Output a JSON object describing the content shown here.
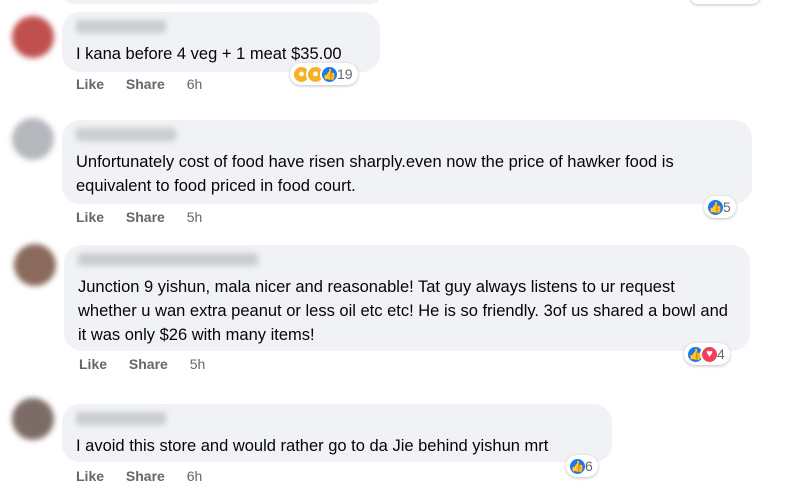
{
  "comments": [
    {
      "text": "I kana before 4 veg + 1 meat $35.00",
      "like": "Like",
      "share": "Share",
      "time": "6h",
      "reactions": [
        "wow-icon",
        "haha-icon",
        "like-icon"
      ],
      "count": "19"
    },
    {
      "text": "Unfortunately cost of food have risen sharply.even now the price of hawker food is equivalent to food priced in food court.",
      "like": "Like",
      "share": "Share",
      "time": "5h",
      "reactions": [
        "like-icon"
      ],
      "count": "5"
    },
    {
      "text": "Junction 9 yishun, mala nicer and reasonable! Tat guy always listens to ur request whether u wan extra peanut or less oil etc etc! He is so friendly. 3of us shared a bowl and it was only $26 with many items!",
      "like": "Like",
      "share": "Share",
      "time": "5h",
      "reactions": [
        "like-icon",
        "love-icon"
      ],
      "count": "4"
    },
    {
      "text": "I avoid this store and would rather go to da Jie behind yishun mrt",
      "like": "Like",
      "share": "Share",
      "time": "6h",
      "reactions": [
        "like-icon"
      ],
      "count": "6"
    }
  ],
  "colors": {
    "bubble": "#f0f2f5",
    "action_text": "#65676b",
    "like_blue": "#1877f2",
    "love_red": "#f33e58",
    "emoji_yellow": "#f7b125"
  }
}
